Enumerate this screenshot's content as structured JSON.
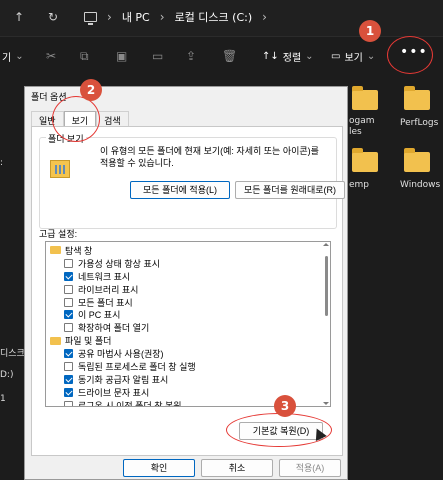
{
  "nav": {
    "back": "←",
    "forward": "→",
    "up": "↑",
    "refresh": "↻"
  },
  "breadcrumb": {
    "sep": "›",
    "item1": "내 PC",
    "item2": "로컬 디스크 (C:)"
  },
  "toolbar": {
    "new_fragment": "기",
    "sort_label": "정렬",
    "view_label": "보기",
    "more": "•••",
    "sort_icon": "↑↓",
    "view_icon": "▭",
    "chevron": "⌄"
  },
  "sidebar_fragments": {
    "frag1": "디스크",
    "frag2": "D:)",
    "frag3": "1"
  },
  "folders": [
    {
      "label": ""
    },
    {
      "label": "PerfLogs"
    },
    {
      "label": "ogam\nles"
    },
    {
      "label": "emp"
    },
    {
      "label": "Windows"
    }
  ],
  "badges": {
    "b1": "1",
    "b2": "2",
    "b3": "3"
  },
  "dialog": {
    "title": "폴더 옵션",
    "tabs": [
      "일반",
      "보기",
      "검색"
    ],
    "folder_views": {
      "label": "폴더 보기",
      "description": "이 유형의 모든 폴더에 현재 보기(예: 자세히 또는 아이콘)를 적용할 수 있습니다.",
      "apply_button": "모든 폴더에 적용(L)",
      "reset_button": "모든 폴더를 원래대로(R)"
    },
    "advanced_label": "고급 설정:",
    "tree": [
      {
        "kind": "category",
        "label": "탐색 창"
      },
      {
        "kind": "check",
        "checked": false,
        "label": "가용성 상태 항상 표시"
      },
      {
        "kind": "check",
        "checked": true,
        "label": "네트워크 표시"
      },
      {
        "kind": "check",
        "checked": false,
        "label": "라이브러리 표시"
      },
      {
        "kind": "check",
        "checked": false,
        "label": "모든 폴더 표시"
      },
      {
        "kind": "check",
        "checked": true,
        "label": "이 PC 표시"
      },
      {
        "kind": "check",
        "checked": false,
        "label": "확장하여 폴더 열기"
      },
      {
        "kind": "category",
        "label": "파일 및 폴더"
      },
      {
        "kind": "check",
        "checked": true,
        "label": "공유 마법사 사용(권장)"
      },
      {
        "kind": "check",
        "checked": false,
        "label": "독립된 프로세스로 폴더 창 실행"
      },
      {
        "kind": "check",
        "checked": true,
        "label": "동기화 공급자 알림 표시"
      },
      {
        "kind": "check",
        "checked": true,
        "label": "드라이브 문자 표시"
      },
      {
        "kind": "check",
        "checked": false,
        "label": "로그온 시 이전 폴더 창 복원"
      }
    ],
    "restore_defaults_button": "기본값 복원(D)",
    "ok_button": "확인",
    "cancel_button": "취소",
    "apply_button": "적용(A)"
  },
  "colors": {
    "accent": "#0067c0",
    "annotation": "#e53935",
    "badge": "#d9513c",
    "folder": "#f2c14e"
  }
}
